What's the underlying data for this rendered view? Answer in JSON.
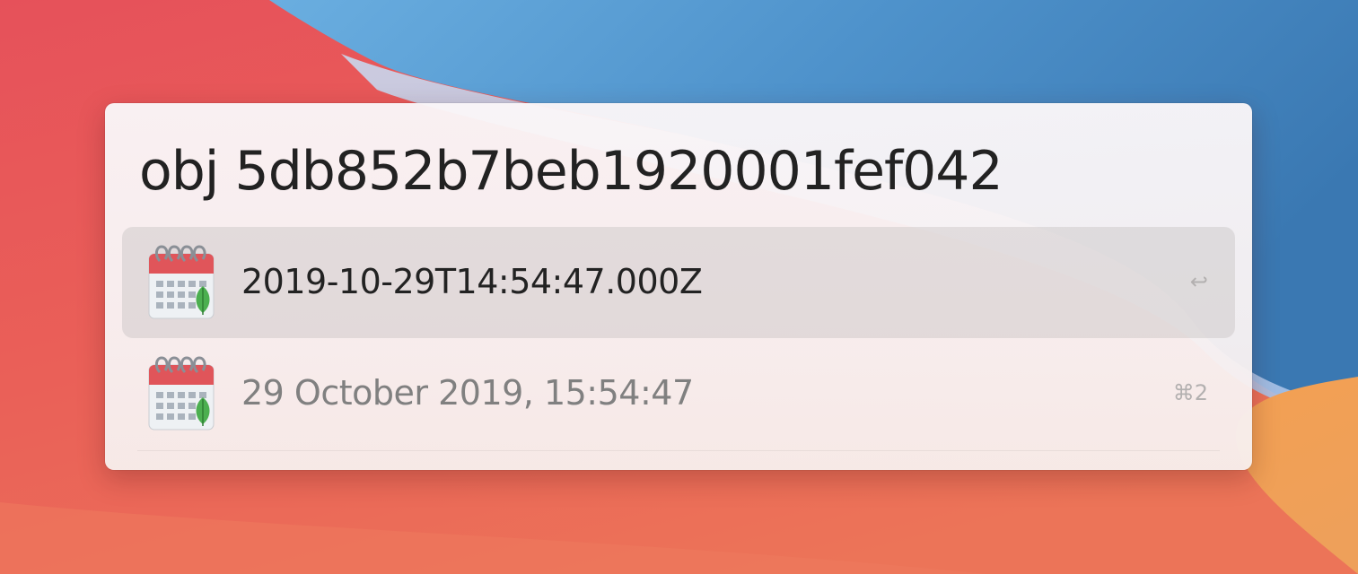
{
  "launcher": {
    "query": "obj 5db852b7beb1920001fef042",
    "results": [
      {
        "title": "2019-10-29T14:54:47.000Z",
        "shortcut": "↩",
        "icon": "calendar-icon",
        "selected": true
      },
      {
        "title": "29 October 2019, 15:54:47",
        "shortcut": "⌘2",
        "icon": "calendar-icon",
        "selected": false
      }
    ]
  },
  "colors": {
    "wallpaper_red": "#e4504f",
    "wallpaper_blue": "#4a90cc",
    "wallpaper_orange": "#f0a050",
    "selection": "#d9d5d5",
    "title_primary": "#222222",
    "title_secondary": "#808080",
    "calendar_red": "#e0555a",
    "calendar_leaf": "#4caf50"
  }
}
